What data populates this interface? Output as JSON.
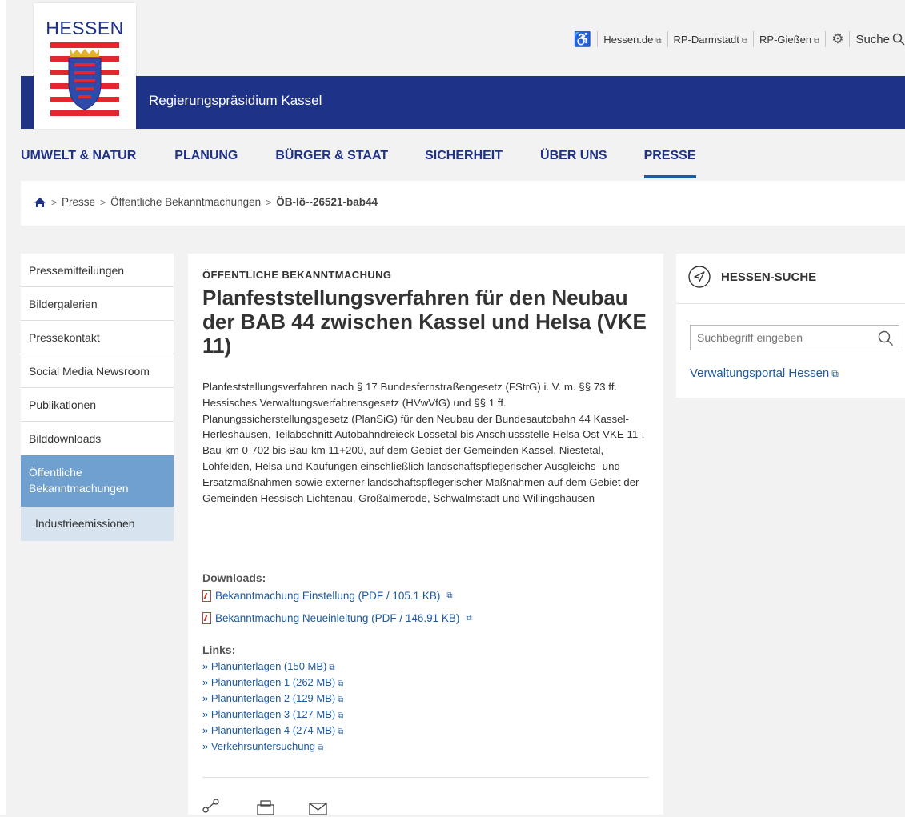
{
  "logo": {
    "word": "HESSEN"
  },
  "site": {
    "name": "Regierungspräsidium Kassel"
  },
  "service": {
    "links": [
      "Hessen.de",
      "RP-Darmstadt",
      "RP-Gießen"
    ],
    "ext_icon": "⧉",
    "search_label": "Suche"
  },
  "nav": {
    "items": [
      "UMWELT & NATUR",
      "PLANUNG",
      "BÜRGER & STAAT",
      "SICHERHEIT",
      "ÜBER UNS",
      "PRESSE"
    ],
    "active": "PRESSE"
  },
  "breadcrumb": {
    "items": [
      "Presse",
      "Öffentliche Bekanntmachungen"
    ],
    "current": "ÖB-lö--26521-bab44"
  },
  "sidebar": {
    "items": [
      {
        "label": "Pressemitteilungen"
      },
      {
        "label": "Bildergalerien"
      },
      {
        "label": "Pressekontakt"
      },
      {
        "label": "Social Media Newsroom"
      },
      {
        "label": "Publikationen"
      },
      {
        "label": "Bilddownloads"
      },
      {
        "label": "Öffentliche Bekanntmachungen"
      },
      {
        "label": "Industrieemissionen"
      }
    ]
  },
  "article": {
    "kicker": "ÖFFENTLICHE BEKANNTMACHUNG",
    "title": "Planfeststellungsverfahren für den Neubau der BAB 44 zwischen Kassel und Helsa (VKE 11)",
    "body": "Planfeststellungsverfahren nach § 17 Bundesfernstraßengesetz (FStrG) i. V. m. §§ 73 ff. Hessisches Verwaltungsverfahrensgesetz (HVwVfG) und §§ 1 ff. Planungssicherstellungsgesetz (PlanSiG) für den Neubau der Bundesautobahn 44 Kassel-Herleshausen, Teilabschnitt Autobahndreieck Lossetal bis Anschlussstelle Helsa Ost-VKE 11-, Bau-km 0-702 bis Bau-km 11+200, auf dem Gebiet der Gemeinden Kassel, Niestetal, Lohfelden, Helsa und Kaufungen einschließlich landschaftspflegerischer Ausgleichs- und Ersatzmaßnahmen sowie externer landschaftspflegerischer Maßnahmen auf dem Gebiet der Gemeinden Hessisch Lichtenau, Großalmerode, Schwalmstadt und Willingshausen",
    "downloads_label": "Downloads:",
    "downloads": [
      "Bekanntmachung Einstellung (PDF / 105.1 KB)",
      "Bekanntmachung Neueinleitung (PDF / 146.91 KB)"
    ],
    "links_label": "Links:",
    "links": [
      "» Planunterlagen (150 MB)",
      "» Planunterlagen 1 (262 MB)",
      "» Planunterlagen 2 (129 MB)",
      "» Planunterlagen 3 (127 MB)",
      "» Planunterlagen 4 (274 MB)",
      "» Verkehrsuntersuchung"
    ]
  },
  "search_box": {
    "heading": "HESSEN-SUCHE",
    "placeholder": "Suchbegriff eingeben",
    "portal_link": "Verwaltungsportal Hessen"
  },
  "colors": {
    "brand_blue": "#1e3287",
    "link_blue": "#1e5aa0",
    "active_side": "#6fa0d0",
    "sub_side": "#d7e3ef"
  }
}
